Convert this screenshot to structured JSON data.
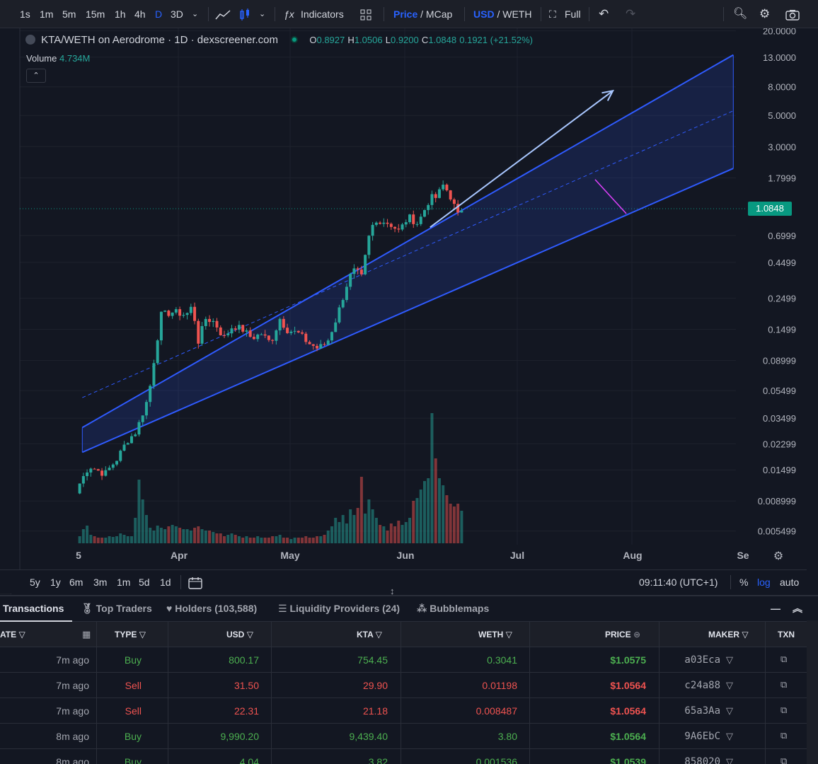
{
  "toolbar": {
    "timeframes": [
      "1s",
      "1m",
      "5m",
      "15m",
      "1h",
      "4h",
      "D",
      "3D"
    ],
    "active_tf": "D",
    "indicators": "Indicators",
    "price": "Price",
    "mcap": "MCap",
    "usd": "USD",
    "weth": "WETH",
    "full": "Full"
  },
  "legend": {
    "title": "KTA/WETH on Aerodrome · 1D · dexscreener.com",
    "o_label": "O",
    "o": "0.8927",
    "h_label": "H",
    "h": "1.0506",
    "l_label": "L",
    "l": "0.9200",
    "c_label": "C",
    "c": "1.0848",
    "change": "0.1921 (+21.52%)",
    "volume_label": "Volume",
    "volume": "4.734M"
  },
  "chart_data": {
    "type": "candlestick",
    "title": "KTA/WETH on Aerodrome · 1D · dexscreener.com",
    "scale": "log",
    "ylim": [
      0.0045,
      20
    ],
    "y_ticks": [
      "20.0000",
      "13.0000",
      "8.0000",
      "5.0000",
      "3.0000",
      "1.7999",
      "0.6999",
      "0.4499",
      "0.2499",
      "0.1499",
      "0.08999",
      "0.05499",
      "0.03499",
      "0.02299",
      "0.01499",
      "0.008999",
      "0.005499"
    ],
    "y_tick_values": [
      20,
      13,
      8,
      5,
      3,
      1.7999,
      0.6999,
      0.4499,
      0.2499,
      0.1499,
      0.08999,
      0.05499,
      0.03499,
      0.02299,
      0.01499,
      0.008999,
      0.005499
    ],
    "x_ticks": [
      "5",
      "Apr",
      "May",
      "Jun",
      "Jul",
      "Aug",
      "Se"
    ],
    "current_price": "1.0848",
    "current_price_value": 1.0848,
    "x_start": "Mar 5",
    "days": 147,
    "candle_count": 104,
    "anchors": [
      [
        0,
        0.012
      ],
      [
        3,
        0.016
      ],
      [
        8,
        0.014
      ],
      [
        12,
        0.018
      ],
      [
        15,
        0.024
      ],
      [
        18,
        0.028
      ],
      [
        22,
        0.05
      ],
      [
        24,
        0.1
      ],
      [
        26,
        0.19
      ],
      [
        30,
        0.2
      ],
      [
        34,
        0.19
      ],
      [
        36,
        0.22
      ],
      [
        38,
        0.12
      ],
      [
        40,
        0.18
      ],
      [
        43,
        0.17
      ],
      [
        46,
        0.13
      ],
      [
        49,
        0.16
      ],
      [
        52,
        0.15
      ],
      [
        55,
        0.13
      ],
      [
        58,
        0.14
      ],
      [
        61,
        0.12
      ],
      [
        64,
        0.18
      ],
      [
        66,
        0.15
      ],
      [
        70,
        0.14
      ],
      [
        73,
        0.12
      ],
      [
        76,
        0.11
      ],
      [
        79,
        0.12
      ],
      [
        82,
        0.18
      ],
      [
        84,
        0.25
      ],
      [
        86,
        0.35
      ],
      [
        88,
        0.4
      ],
      [
        90,
        0.35
      ],
      [
        93,
        0.8
      ],
      [
        96,
        0.9
      ],
      [
        99,
        0.85
      ],
      [
        102,
        0.75
      ],
      [
        105,
        0.95
      ],
      [
        108,
        0.85
      ],
      [
        112,
        1.3
      ],
      [
        114,
        1.3
      ],
      [
        116,
        1.6
      ],
      [
        118,
        1.4
      ],
      [
        121,
        0.95
      ],
      [
        122,
        1.08
      ]
    ],
    "volume_heights": [
      10,
      20,
      25,
      12,
      10,
      8,
      8,
      8,
      10,
      9,
      10,
      14,
      12,
      10,
      10,
      36,
      90,
      62,
      40,
      22,
      18,
      25,
      22,
      20,
      24,
      26,
      24,
      22,
      20,
      20,
      18,
      22,
      24,
      20,
      18,
      18,
      16,
      14,
      14,
      10,
      12,
      14,
      12,
      10,
      8,
      10,
      8,
      8,
      10,
      8,
      8,
      8,
      10,
      10,
      12,
      8,
      8,
      6,
      8,
      8,
      8,
      10,
      8,
      8,
      10,
      10,
      12,
      18,
      24,
      36,
      30,
      40,
      28,
      48,
      40,
      50,
      94,
      42,
      62,
      48,
      36,
      26,
      24,
      18,
      28,
      24,
      32,
      26,
      30,
      36,
      60,
      64,
      76,
      88,
      92,
      184,
      120,
      92,
      82,
      68,
      56,
      52,
      56,
      46
    ],
    "channel": {
      "upper": [
        [
          1,
          0.03
        ],
        [
          147,
          13.5
        ]
      ],
      "lower": [
        [
          1,
          0.02
        ],
        [
          147,
          2.1
        ]
      ],
      "mid_dashed": [
        [
          1,
          0.049
        ],
        [
          147,
          5.4
        ]
      ]
    },
    "arrow": [
      [
        79,
        0.8
      ],
      [
        120,
        7.5
      ]
    ],
    "annotation": "pink trendline near top"
  },
  "bottom": {
    "ranges": [
      "5y",
      "1y",
      "6m",
      "3m",
      "1m",
      "5d",
      "1d"
    ],
    "clock": "09:11:40 (UTC+1)",
    "pct": "%",
    "log": "log",
    "auto": "auto"
  },
  "panel": {
    "tabs": [
      "Transactions",
      "Top Traders",
      "Holders (103,588)",
      "Liquidity Providers (24)",
      "Bubblemaps"
    ],
    "headers": [
      "ATE",
      "TYPE",
      "USD",
      "KTA",
      "WETH",
      "PRICE",
      "MAKER",
      "TXN"
    ],
    "rows": [
      {
        "age": "7m ago",
        "type": "Buy",
        "usd": "800.17",
        "kta": "754.45",
        "weth": "0.3041",
        "price": "$1.0575",
        "maker": "a03Eca"
      },
      {
        "age": "7m ago",
        "type": "Sell",
        "usd": "31.50",
        "kta": "29.90",
        "weth": "0.01198",
        "price": "$1.0564",
        "maker": "c24a88"
      },
      {
        "age": "7m ago",
        "type": "Sell",
        "usd": "22.31",
        "kta": "21.18",
        "weth": "0.008487",
        "price": "$1.0564",
        "maker": "65a3Aa"
      },
      {
        "age": "8m ago",
        "type": "Buy",
        "usd": "9,990.20",
        "kta": "9,439.40",
        "weth": "3.80",
        "price": "$1.0564",
        "maker": "9A6EbC"
      },
      {
        "age": "8m ago",
        "type": "Buy",
        "usd": "4.04",
        "kta": "3.82",
        "weth": "0.001536",
        "price": "$1.0539",
        "maker": "858020"
      }
    ]
  },
  "colors": {
    "up": "#26a69a",
    "down": "#ef5350",
    "channel": "#2f5bff",
    "accent": "#2962ff"
  }
}
